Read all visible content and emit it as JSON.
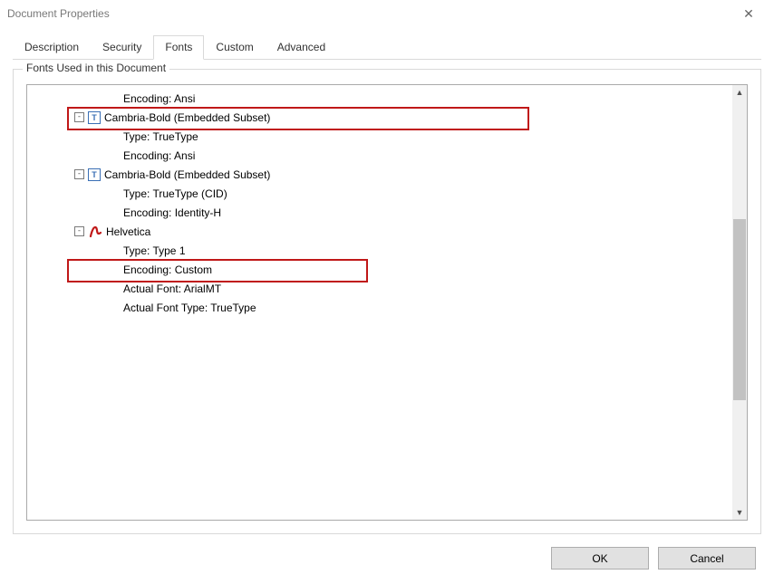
{
  "window": {
    "title": "Document Properties"
  },
  "tabs": {
    "t0": "Description",
    "t1": "Security",
    "t2": "Fonts",
    "t3": "Custom",
    "t4": "Advanced",
    "active": "t2"
  },
  "fieldset": {
    "legend": "Fonts Used in this Document"
  },
  "tree": {
    "r0": "Encoding: Ansi",
    "r1": "Cambria-Bold (Embedded Subset)",
    "r1a": "Type: TrueType",
    "r1b": "Encoding: Ansi",
    "r2": "Cambria-Bold (Embedded Subset)",
    "r2a": "Type: TrueType (CID)",
    "r2b": "Encoding: Identity-H",
    "r3": "Helvetica",
    "r3a": "Type: Type 1",
    "r3b": "Encoding: Custom",
    "r3c": "Actual Font: ArialMT",
    "r3d": "Actual Font Type: TrueType"
  },
  "buttons": {
    "ok": "OK",
    "cancel": "Cancel"
  },
  "expander_glyph": "⊟"
}
